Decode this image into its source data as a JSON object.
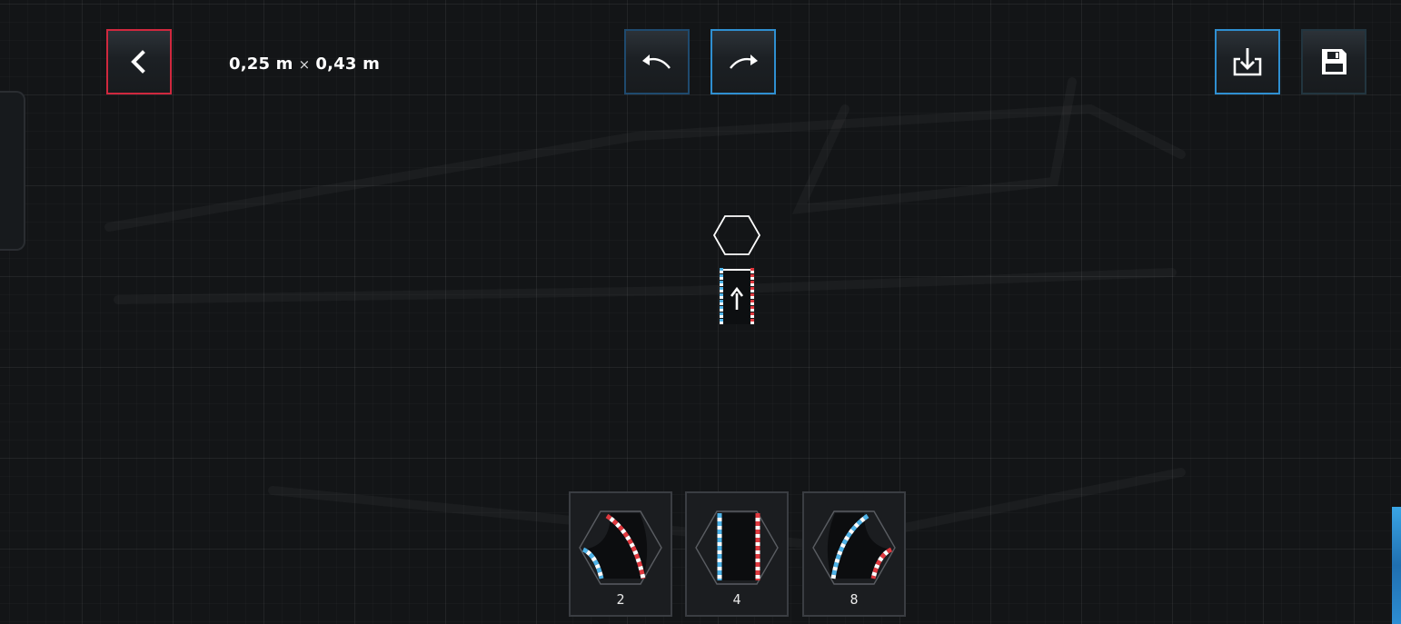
{
  "toolbar": {
    "back_icon": "chevron-left-icon",
    "undo_icon": "undo-arrow-icon",
    "redo_icon": "redo-arrow-icon",
    "import_icon": "import-tray-icon",
    "save_icon": "floppy-save-icon"
  },
  "dimensions": {
    "width": "0,25 m",
    "separator": "×",
    "height": "0,43 m"
  },
  "canvas": {
    "cursor_icon": "hexagon-icon",
    "track_piece_icon": "straight-track-arrow-icon"
  },
  "palette": [
    {
      "name": "curve-left",
      "count": "2"
    },
    {
      "name": "straight",
      "count": "4"
    },
    {
      "name": "curve-right",
      "count": "8"
    }
  ],
  "colors": {
    "accent_red": "#d0283e",
    "accent_blue": "#2f8fd1",
    "kerb_red": "#e0393f",
    "kerb_blue": "#4fb3e8"
  }
}
